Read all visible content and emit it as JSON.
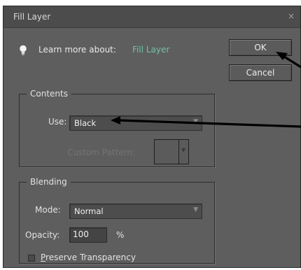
{
  "dialog": {
    "title": "Fill Layer",
    "close_glyph": "×"
  },
  "learn": {
    "label": "Learn more about:",
    "link": "Fill Layer",
    "icon": "lightbulb-icon"
  },
  "buttons": {
    "ok": "OK",
    "cancel": "Cancel"
  },
  "contents": {
    "legend": "Contents",
    "use_label": "Use:",
    "use_value": "Black",
    "custom_pattern_label": "Custom Pattern:"
  },
  "blending": {
    "legend": "Blending",
    "mode_label": "Mode:",
    "mode_value": "Normal",
    "opacity_label": "Opacity:",
    "opacity_value": "100",
    "opacity_unit": "%",
    "preserve_first": "P",
    "preserve_rest": "reserve Transparency",
    "preserve_checked": false
  },
  "colors": {
    "dialog_bg": "#5e5e5e",
    "link": "#74c0a2",
    "annotation_arrow": "#000000"
  }
}
